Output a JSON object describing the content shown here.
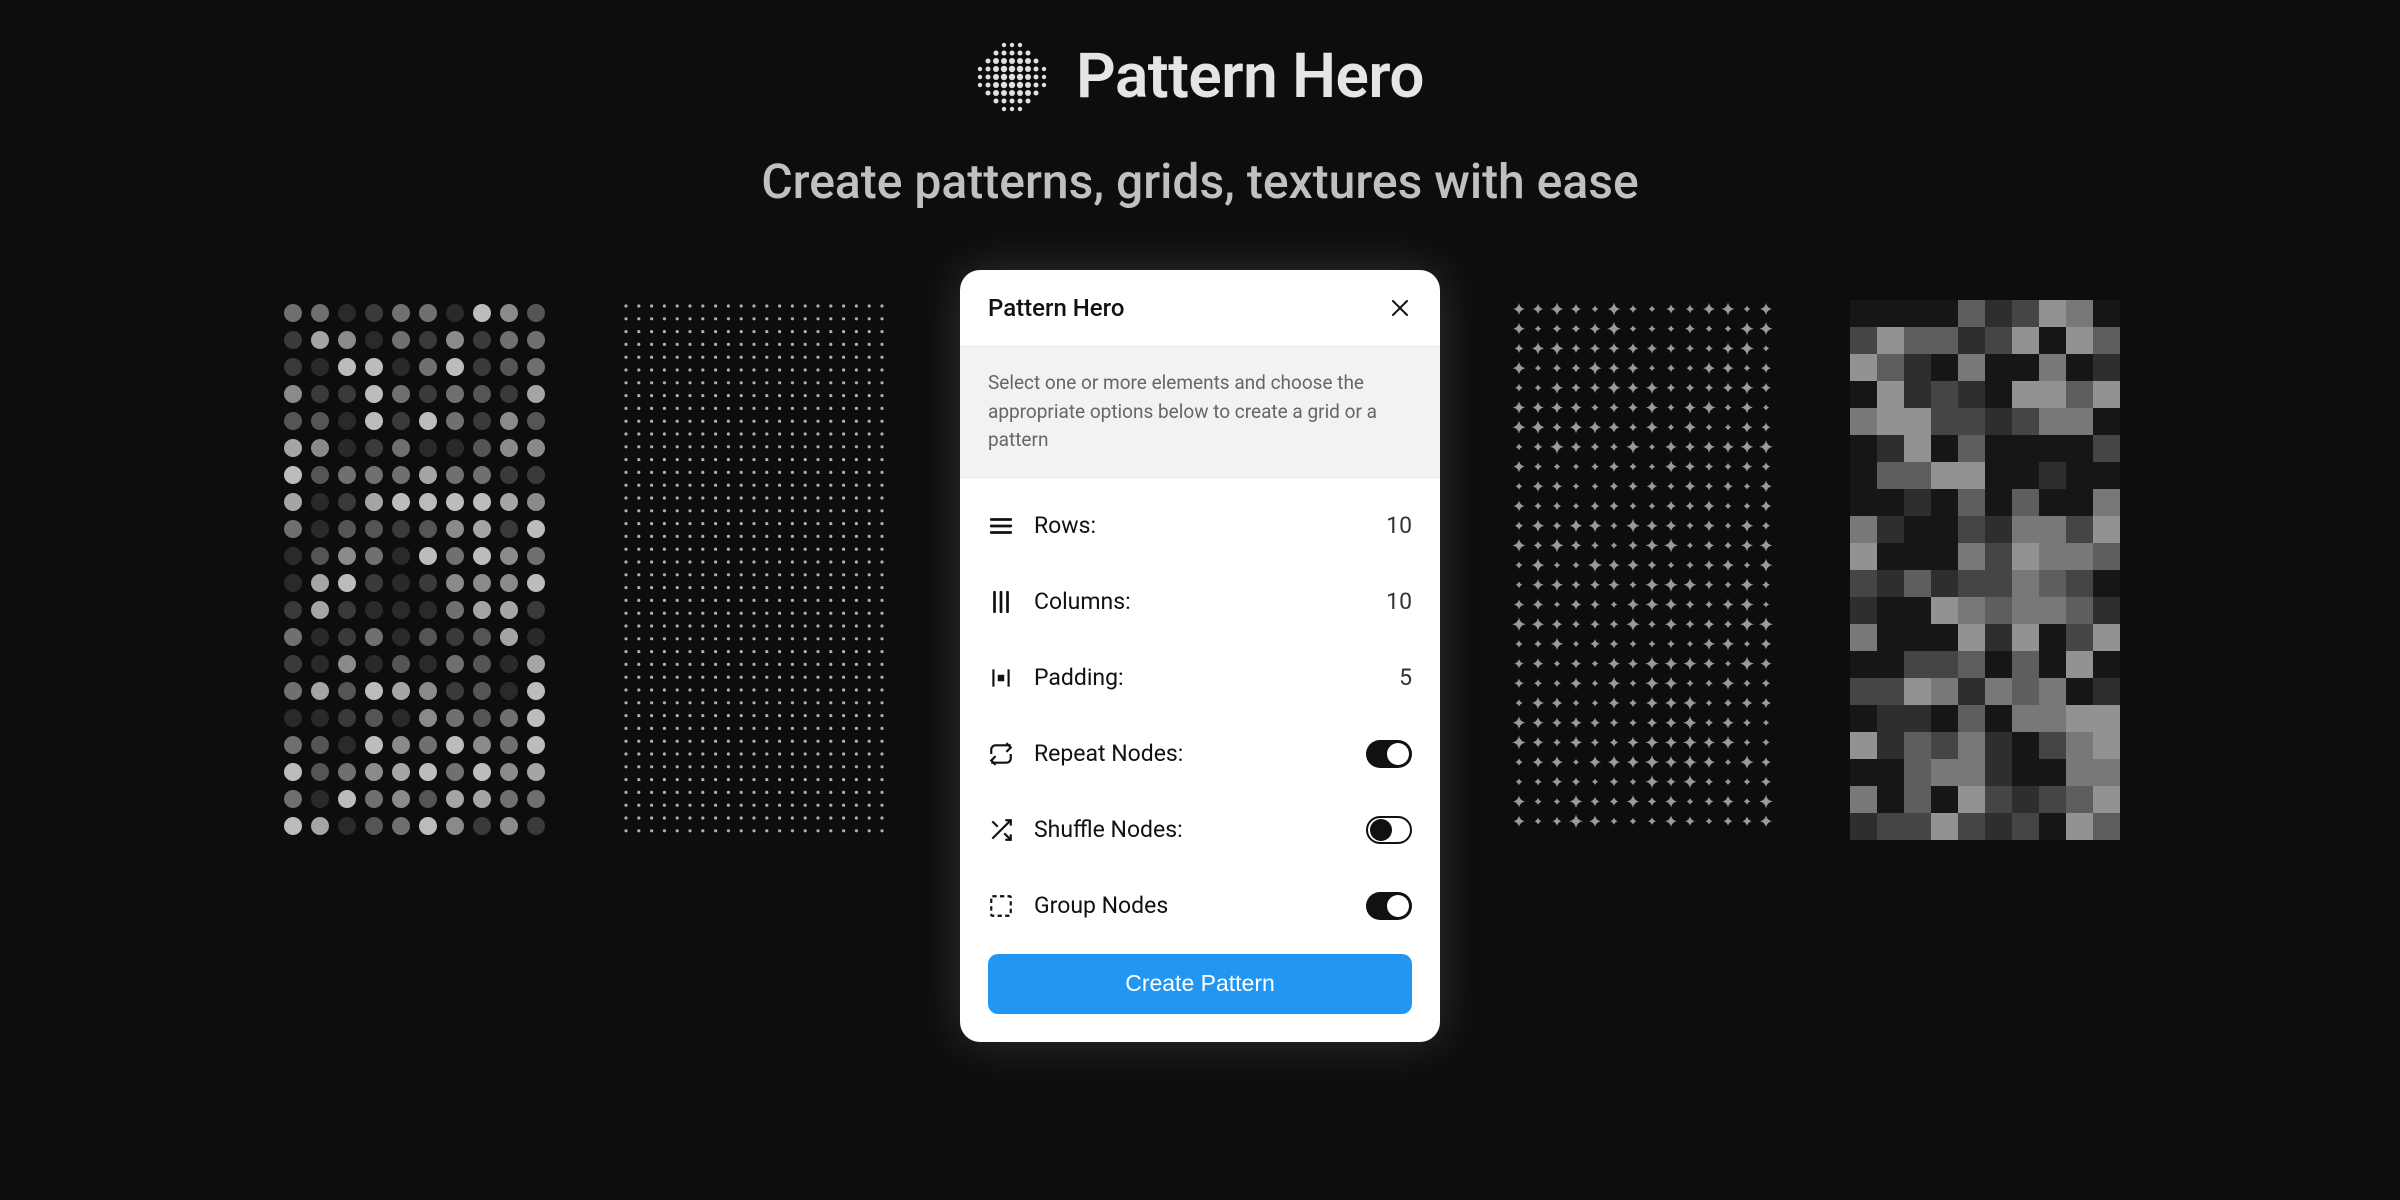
{
  "brand": {
    "title": "Pattern Hero"
  },
  "subtitle": "Create patterns, grids, textures with ease",
  "panel": {
    "title": "Pattern Hero",
    "description": "Select one or more elements and choose the appropriate options below to create a grid or a pattern",
    "rows": {
      "rows_label": "Rows:",
      "rows_value": "10",
      "columns_label": "Columns:",
      "columns_value": "10",
      "padding_label": "Padding:",
      "padding_value": "5",
      "repeat_label": "Repeat Nodes:",
      "repeat_on": true,
      "shuffle_label": "Shuffle Nodes:",
      "shuffle_on": false,
      "group_label": "Group Nodes",
      "group_on": true
    },
    "create_button": "Create Pattern"
  },
  "colors": {
    "accent": "#2196f3",
    "bg": "#0d0d0d"
  }
}
